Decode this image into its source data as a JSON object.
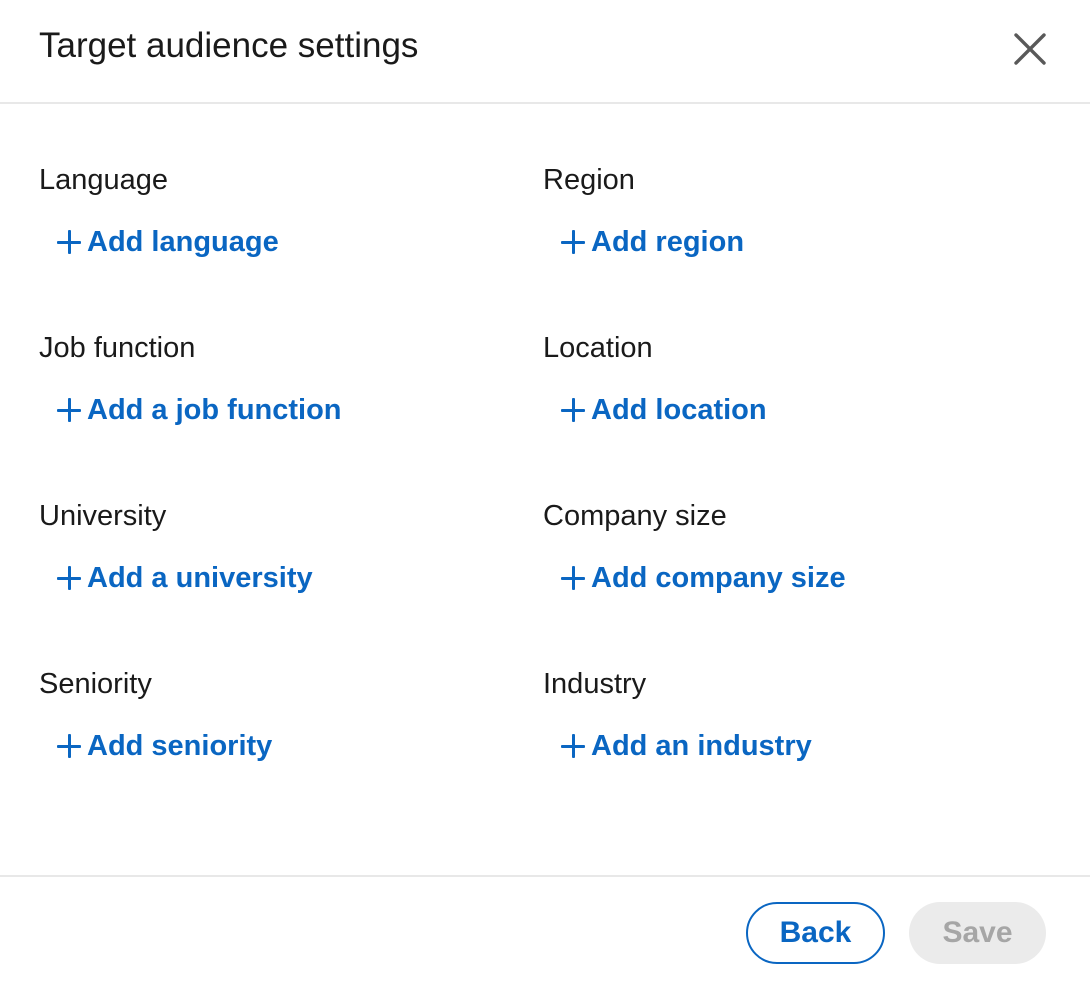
{
  "header": {
    "title": "Target audience settings",
    "close_icon": "close-icon"
  },
  "fields": [
    {
      "label": "Language",
      "action": "Add language"
    },
    {
      "label": "Region",
      "action": "Add region"
    },
    {
      "label": "Job function",
      "action": "Add a job function"
    },
    {
      "label": "Location",
      "action": "Add location"
    },
    {
      "label": "University",
      "action": "Add a university"
    },
    {
      "label": "Company size",
      "action": "Add company size"
    },
    {
      "label": "Seniority",
      "action": "Add seniority"
    },
    {
      "label": "Industry",
      "action": "Add an industry"
    }
  ],
  "footer": {
    "back_label": "Back",
    "save_label": "Save",
    "save_disabled": true
  },
  "colors": {
    "accent": "#0a66c2",
    "disabled_bg": "#ebebeb",
    "disabled_text": "#a6a6a6",
    "divider": "#e8e8e8"
  }
}
